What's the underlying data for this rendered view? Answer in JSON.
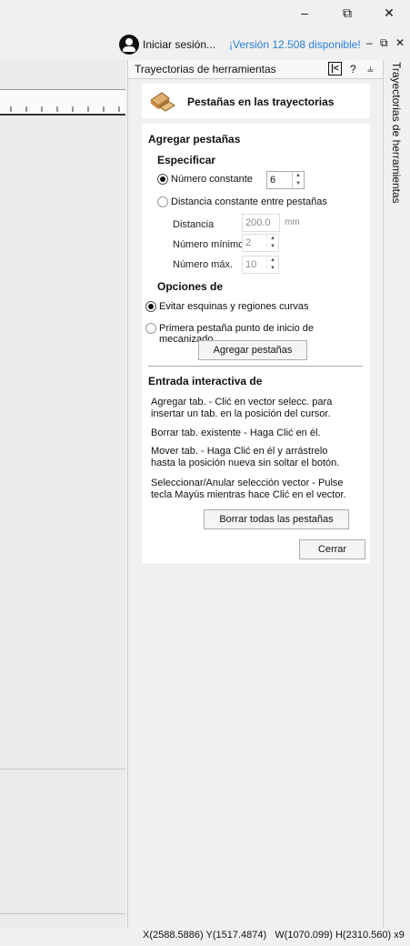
{
  "window": {
    "minimize": "–",
    "restore": "⧉",
    "close": "✕",
    "sub_minimize": "–",
    "sub_restore": "⧉",
    "sub_close": "✕"
  },
  "account": {
    "signin_label": "Iniciar sesión...",
    "version_label": "¡Versión 12.508 disponible!"
  },
  "panel": {
    "title": "Trayectorias de herramientas",
    "help": "?",
    "pin": "⫨",
    "side_tab": "Trayectorias de herramientas"
  },
  "header": {
    "title": "Pestañas en las trayectorias"
  },
  "add_tabs": {
    "section_title": "Agregar pestañas",
    "specify_title": "Especificar",
    "constant_number_label": "Número constante",
    "constant_number_value": "6",
    "constant_distance_label": "Distancia constante entre pestañas",
    "distance_label": "Distancia",
    "distance_value": "200.0",
    "distance_unit": "mm",
    "min_number_label": "Número mínimo",
    "min_number_value": "2",
    "max_number_label": "Número máx.",
    "max_number_value": "10",
    "options_title": "Opciones de",
    "avoid_corners_label": "Evitar esquinas y regiones curvas",
    "first_tab_label": "Primera pestaña punto de inicio de mecanizado",
    "add_button": "Agregar pestañas"
  },
  "interactive": {
    "title": "Entrada interactiva de",
    "line1": "Agregar tab. - Clić en vector selecc. para insertar un tab. en la posición del cursor.",
    "line2": "Borrar tab. existente - Haga Clić en él.",
    "line3": "Mover tab. - Haga Clić en él y arrástrelo hasta la posición nueva sin soltar el botón.",
    "line4": "Seleccionar/Anular selección vector - Pulse tecla Mayús mientras hace Clić en el vector.",
    "clear_button": "Borrar todas las pestañas",
    "close_button": "Cerrar"
  },
  "status": {
    "coords": "X(2588.5886) Y(1517.4874)   W(1070.099) H(2310.560) x9"
  }
}
